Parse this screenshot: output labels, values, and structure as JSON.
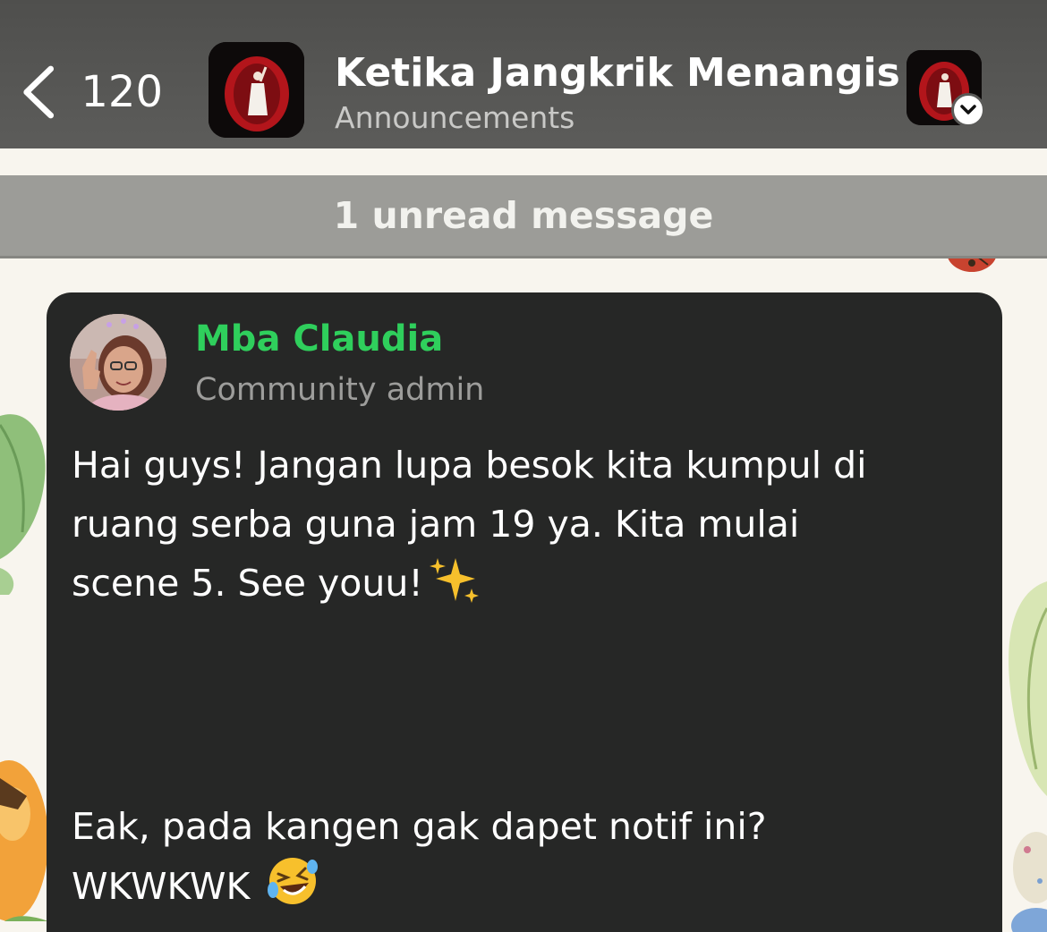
{
  "header": {
    "back_count": "120",
    "group_title": "Ketika Jangkrik Menangis",
    "group_subtitle": "Announcements",
    "icons": {
      "back": "chevron-left-icon",
      "switcher": "chevron-down-icon"
    }
  },
  "unread_banner": {
    "text": "1 unread message"
  },
  "message": {
    "sender_name": "Mba Claudia",
    "sender_role": "Community admin",
    "paragraph_1": [
      "Hai guys! Jangan lupa besok kita kumpul di",
      "ruang serba guna jam 19 ya. Kita mulai",
      "scene 5. See youu!"
    ],
    "paragraph_1_emoji": "sparkles",
    "paragraph_2": [
      "Eak, pada kangen gak dapet notif ini?",
      "WKWKWK"
    ],
    "paragraph_2_emoji": "rolling-on-floor-laughing"
  },
  "colors": {
    "header_bg": "#565654",
    "unread_bg": "#9c9c98",
    "card_bg": "#262726",
    "sender_name": "#2fcf5c",
    "wallpaper": "#f8f5ee"
  }
}
